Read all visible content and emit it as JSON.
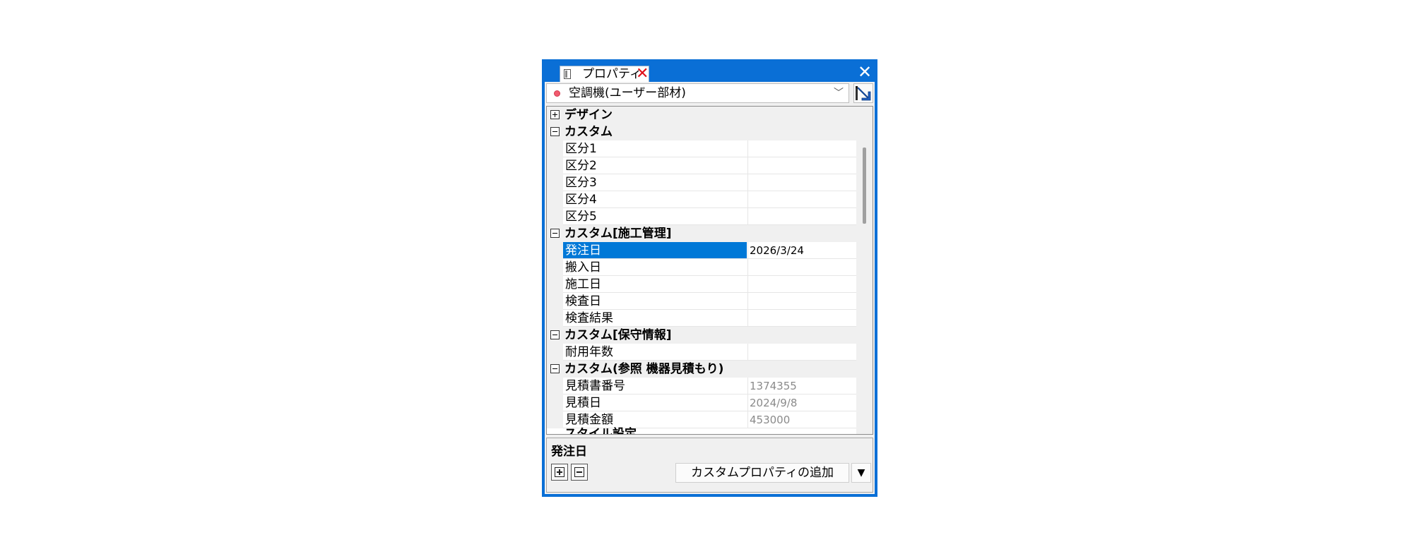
{
  "panel": {
    "tab_label": "プロパティ",
    "tab_close_glyph": "✕",
    "close_glyph": "✕"
  },
  "object_selector": {
    "value": "空調機(ユーザー部材)",
    "chevron": "﹀"
  },
  "grid": {
    "categories": [
      {
        "label": "デザイン",
        "expanded": false,
        "rows": []
      },
      {
        "label": "カスタム",
        "expanded": true,
        "rows": [
          {
            "name": "区分1",
            "value": ""
          },
          {
            "name": "区分2",
            "value": ""
          },
          {
            "name": "区分3",
            "value": ""
          },
          {
            "name": "区分4",
            "value": ""
          },
          {
            "name": "区分5",
            "value": ""
          }
        ]
      },
      {
        "label": "カスタム[施工管理]",
        "expanded": true,
        "rows": [
          {
            "name": "発注日",
            "value": "2026/3/24",
            "selected": true
          },
          {
            "name": "搬入日",
            "value": ""
          },
          {
            "name": "施工日",
            "value": ""
          },
          {
            "name": "検査日",
            "value": ""
          },
          {
            "name": "検査結果",
            "value": ""
          }
        ]
      },
      {
        "label": "カスタム[保守情報]",
        "expanded": true,
        "rows": [
          {
            "name": "耐用年数",
            "value": ""
          }
        ]
      },
      {
        "label": "カスタム(参照 機器見積もり)",
        "expanded": true,
        "rows": [
          {
            "name": "見積書番号",
            "value": "1374355",
            "readonly": true
          },
          {
            "name": "見積日",
            "value": "2024/9/8",
            "readonly": true
          },
          {
            "name": "見積金額",
            "value": "453000",
            "readonly": true
          }
        ]
      }
    ],
    "partial_category_label": "スタイル設定"
  },
  "description": {
    "title": "発注日"
  },
  "footer": {
    "add_button_label": "カスタムプロパティの追加",
    "dropdown_glyph": "▼"
  },
  "colors": {
    "accent": "#0a6fd6",
    "selection": "#0078d7",
    "close_red": "#e0101a"
  }
}
